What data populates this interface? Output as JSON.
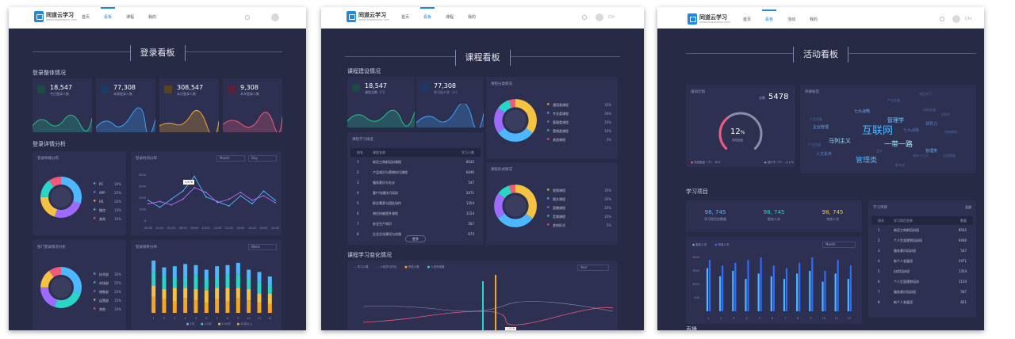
{
  "screens": [
    {
      "logo": {
        "name": "同道云学习",
        "sub": "www.tongdaoyun.com"
      },
      "nav": [
        "首页",
        "看板",
        "课程",
        "我的"
      ],
      "nav_active": 1,
      "user": "",
      "page_title": "登录看板",
      "section_overview": "登录整体情况",
      "stats": [
        {
          "value": "18,547",
          "label": "今日登录人数",
          "color": "#25c08b",
          "icon": "home-icon"
        },
        {
          "value": "77,308",
          "label": "本周登录人数",
          "color": "#3aa3ff",
          "icon": "pen-icon"
        },
        {
          "value": "308,547",
          "label": "本月登录人数",
          "color": "#f5a623",
          "icon": "bulb-icon"
        },
        {
          "value": "9,308",
          "label": "本年登录人数",
          "color": "#f15a7b",
          "icon": "lock-icon"
        }
      ],
      "section_trend": "登录详情分析",
      "panel_terminal": "登录终端分布",
      "terminal_legend": [
        {
          "name": "PC",
          "pct": "30%",
          "color": "#4db8ff"
        },
        {
          "name": "APP",
          "pct": "25%",
          "color": "#9e6bff"
        },
        {
          "name": "H5",
          "pct": "20%",
          "color": "#f5c242"
        },
        {
          "name": "微信",
          "pct": "15%",
          "color": "#2ad5c7"
        },
        {
          "name": "其他",
          "pct": "10%",
          "color": "#f15a7b"
        }
      ],
      "panel_time": "登录时间分布",
      "time_select_1": "Month",
      "time_select_2": "Day",
      "time_tooltip": "3,876",
      "time_ticks": [
        "00:00",
        "02:00",
        "04:00",
        "06:00",
        "08:00",
        "10:00",
        "12:00",
        "14:00",
        "16:00",
        "18:00",
        "20:00",
        "22:00"
      ],
      "panel_dept": "部门登录情况分析",
      "dept_legend": [
        {
          "name": "技术部",
          "pct": "30%",
          "color": "#4db8ff"
        },
        {
          "name": "市场部",
          "pct": "25%",
          "color": "#2ad5c7"
        },
        {
          "name": "销售部",
          "pct": "20%",
          "color": "#9e6bff"
        },
        {
          "name": "运营部",
          "pct": "15%",
          "color": "#f5c242"
        },
        {
          "name": "其他",
          "pct": "10%",
          "color": "#f15a7b"
        }
      ],
      "panel_bars": "登录频率分布",
      "bars_select": "Week",
      "bars_legend": [
        "1次",
        "2-5次",
        "5-10次",
        "10次以上"
      ]
    },
    {
      "logo": {
        "name": "同道云学习",
        "sub": "www.tongdaoyun.com"
      },
      "nav": [
        "首页",
        "看板",
        "课程",
        "我的"
      ],
      "nav_active": 1,
      "user": "Chi",
      "page_title": "课程看板",
      "section_overview": "课程建设情况",
      "stats": [
        {
          "value": "18,547",
          "label": "课程总数（门）",
          "color": "#25c08b",
          "icon": "home-icon"
        },
        {
          "value": "77,308",
          "label": "学习总人次（人）",
          "color": "#3aa3ff",
          "icon": "pen-icon"
        }
      ],
      "panel_type": "课程分类情况",
      "type_legend": [
        {
          "name": "通用类课程",
          "pct": "35%",
          "color": "#f5c242"
        },
        {
          "name": "专业类课程",
          "pct": "30%",
          "color": "#4db8ff"
        },
        {
          "name": "管理类课程",
          "pct": "20%",
          "color": "#9e6bff"
        },
        {
          "name": "营销类课程",
          "pct": "10%",
          "color": "#2ad5c7"
        },
        {
          "name": "其他课程",
          "pct": "5%",
          "color": "#f15a7b"
        }
      ],
      "panel_rank": "课程学习排名",
      "rank_headers": [
        "排名",
        "课程名称",
        "学习人数"
      ],
      "rank_rows": [
        [
          "1",
          "新员工岗前培训课程",
          "8542"
        ],
        [
          "2",
          "产品知识与营销技巧课程",
          "6446"
        ],
        [
          "3",
          "服务意识与礼仪",
          "547"
        ],
        [
          "4",
          "客户沟通技巧培训",
          "2471"
        ],
        [
          "5",
          "职业素养与团队协作",
          "1354"
        ],
        [
          "6",
          "岗位技能提升课程",
          "1154"
        ],
        [
          "7",
          "安全生产知识",
          "567"
        ],
        [
          "8",
          "企业文化建设与实践",
          "673"
        ]
      ],
      "rank_more": "更多",
      "panel_form": "课程形式情况",
      "form_legend": [
        {
          "name": "视频课程",
          "pct": "35%",
          "color": "#f5c242"
        },
        {
          "name": "图文课程",
          "pct": "30%",
          "color": "#4db8ff"
        },
        {
          "name": "直播课程",
          "pct": "20%",
          "color": "#9e6bff"
        },
        {
          "name": "音频课程",
          "pct": "10%",
          "color": "#2ad5c7"
        },
        {
          "name": "其他形式",
          "pct": "5%",
          "color": "#f15a7b"
        }
      ],
      "section_change": "课程学习变化情况",
      "change_legend": [
        {
          "name": "学习人数",
          "color": "#9aa0c8"
        },
        {
          "name": "人均学习时长",
          "color": "#f15a7b"
        },
        {
          "name": "完成人数",
          "color": "#f5a623"
        },
        {
          "name": "人均完成数",
          "color": "#2ad5c7"
        }
      ],
      "change_select": "Year",
      "change_tooltip": "1,876"
    },
    {
      "logo": {
        "name": "同道云学习",
        "sub": "www.tongdaoyun.com"
      },
      "nav": [
        "首页",
        "看板",
        "活动",
        "我的"
      ],
      "nav_active": 1,
      "user": "Chi",
      "page_title": "活动看板",
      "panel_plan": "培训计划",
      "plan_total_label": "总数",
      "plan_total": "5478",
      "plan_pct": "12",
      "plan_pct_unit": "%",
      "plan_gauge_label": "完成进度",
      "plan_legend": [
        "完成数量（个）: 621",
        "进行中（个）: 4,175"
      ],
      "panel_tags": "热搜标签",
      "tags": [
        {
          "text": "互联网",
          "size": 13,
          "color": "#4db8ff"
        },
        {
          "text": "一带一路",
          "size": 9,
          "color": "#a8e6ff"
        },
        {
          "text": "管理类",
          "size": 9,
          "color": "#4db8ff"
        },
        {
          "text": "管理学",
          "size": 7,
          "color": "#7ec8ff"
        },
        {
          "text": "马列主义",
          "size": 7,
          "color": "#9ee6ff"
        },
        {
          "text": "七大战略",
          "size": 5,
          "color": "#6aa8e8"
        },
        {
          "text": "七大战略",
          "size": 5,
          "color": "#4a7ac8"
        },
        {
          "text": "企业管理",
          "size": 5,
          "color": "#6aa8e8"
        },
        {
          "text": "领导力",
          "size": 5,
          "color": "#5b8ad0"
        },
        {
          "text": "人文素养",
          "size": 5,
          "color": "#5b8ad0"
        },
        {
          "text": "管理类",
          "size": 5,
          "color": "#6aa8e8"
        },
        {
          "text": "产业发展",
          "size": 4,
          "color": "#4a6aa8"
        },
        {
          "text": "产业发展",
          "size": 4,
          "color": "#4a6aa8"
        },
        {
          "text": "创新发展",
          "size": 4,
          "color": "#4a6aa8"
        },
        {
          "text": "2020",
          "size": 4,
          "color": "#4a6aa8"
        },
        {
          "text": "创新精神",
          "size": 4,
          "color": "#4a6aa8"
        },
        {
          "text": "党史学习",
          "size": 4,
          "color": "#4a6aa8"
        },
        {
          "text": "会计",
          "size": 4,
          "color": "#4a6aa8"
        },
        {
          "text": "党的十九大",
          "size": 4,
          "color": "#4a6aa8"
        },
        {
          "text": "自我管理",
          "size": 4,
          "color": "#4a6aa8"
        },
        {
          "text": "产业发展",
          "size": 4,
          "color": "#4a6aa8"
        },
        {
          "text": "数字化",
          "size": 4,
          "color": "#4a6aa8"
        }
      ],
      "section_learn": "学习项目",
      "learn_stats": [
        {
          "value": "98, 745",
          "label": "学习项目总数量",
          "color": "#4db8ff"
        },
        {
          "value": "98, 745",
          "label": "报名人次",
          "color": "#2ad5c7"
        },
        {
          "value": "98, 745",
          "label": "完成人次",
          "color": "#f5c242"
        }
      ],
      "bars_legend": [
        {
          "name": "报名人次",
          "color": "#4db8ff"
        },
        {
          "name": "完成人次",
          "color": "#2f6bff"
        }
      ],
      "bars_select": "Month",
      "bars_yticks": [
        "2000",
        "1500",
        "1000",
        "500"
      ],
      "bars_xticks": [
        "1",
        "2",
        "3",
        "4",
        "5",
        "6",
        "7",
        "8",
        "9",
        "10",
        "11",
        "12"
      ],
      "panel_rank": "学习项目",
      "rank_more": "全部",
      "rank_headers": [
        "排名",
        "学习项目名称",
        "数量"
      ],
      "rank_rows": [
        [
          "1",
          "新员工岗前培训班",
          "8542"
        ],
        [
          "2",
          "个人生涯规划培训班",
          "6446"
        ],
        [
          "3",
          "服务意识培训班",
          "547"
        ],
        [
          "4",
          "新个人发展班",
          "2471"
        ],
        [
          "5",
          "自信培训班",
          "1354"
        ],
        [
          "6",
          "个人生涯规划培训",
          "1154"
        ],
        [
          "7",
          "服务意识培训班",
          "567"
        ],
        [
          "8",
          "新个人发展班",
          "821"
        ]
      ],
      "section_bottom": "直播"
    }
  ],
  "chart_data": [
    {
      "type": "line",
      "title": "登录时间分布",
      "x": [
        "00:00",
        "02:00",
        "04:00",
        "06:00",
        "08:00",
        "10:00",
        "12:00",
        "14:00",
        "16:00",
        "18:00",
        "20:00",
        "22:00"
      ],
      "series": [
        {
          "values": [
            1800,
            1200,
            1900,
            2600,
            3876,
            2100,
            1700,
            1300,
            2200,
            1500,
            2600,
            1800
          ]
        },
        {
          "values": [
            1500,
            1700,
            1400,
            1900,
            2900,
            2500,
            1600,
            1900,
            2500,
            1800,
            2200,
            1600
          ]
        }
      ],
      "ylim": [
        0,
        4000
      ]
    },
    {
      "type": "bar",
      "title": "学习项目",
      "categories": [
        "1",
        "2",
        "3",
        "4",
        "5",
        "6",
        "7",
        "8",
        "9",
        "10",
        "11",
        "12"
      ],
      "series": [
        {
          "name": "报名人次",
          "values": [
            1600,
            1300,
            1500,
            1200,
            1400,
            1300,
            1200,
            1400,
            1500,
            1100,
            1400,
            1200
          ]
        },
        {
          "name": "完成人次",
          "values": [
            1900,
            1700,
            1800,
            1900,
            2000,
            1700,
            1600,
            1800,
            2000,
            1500,
            1900,
            1700
          ]
        }
      ],
      "ylim": [
        0,
        2000
      ]
    }
  ]
}
